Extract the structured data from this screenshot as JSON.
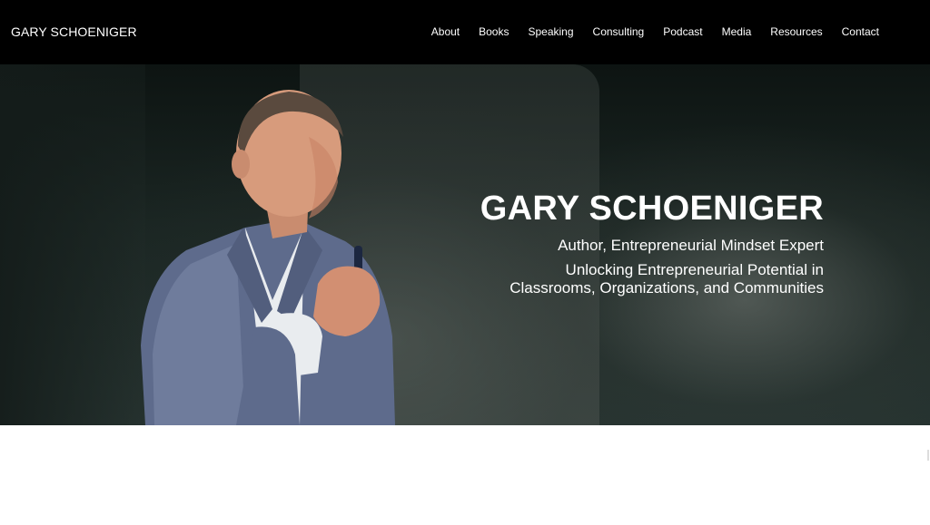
{
  "header": {
    "brand": "GARY SCHOENIGER",
    "nav": [
      "About",
      "Books",
      "Speaking",
      "Consulting",
      "Podcast",
      "Media",
      "Resources",
      "Contact"
    ]
  },
  "hero": {
    "title": "GARY SCHOENIGER",
    "subtitle": "Author, Entrepreneurial Mindset Expert",
    "tagline_line1": "Unlocking Entrepreneurial Potential in",
    "tagline_line2": "Classrooms, Organizations, and Communities"
  },
  "colors": {
    "header_bg": "#000000",
    "text": "#ffffff",
    "page_bg": "#ffffff"
  }
}
